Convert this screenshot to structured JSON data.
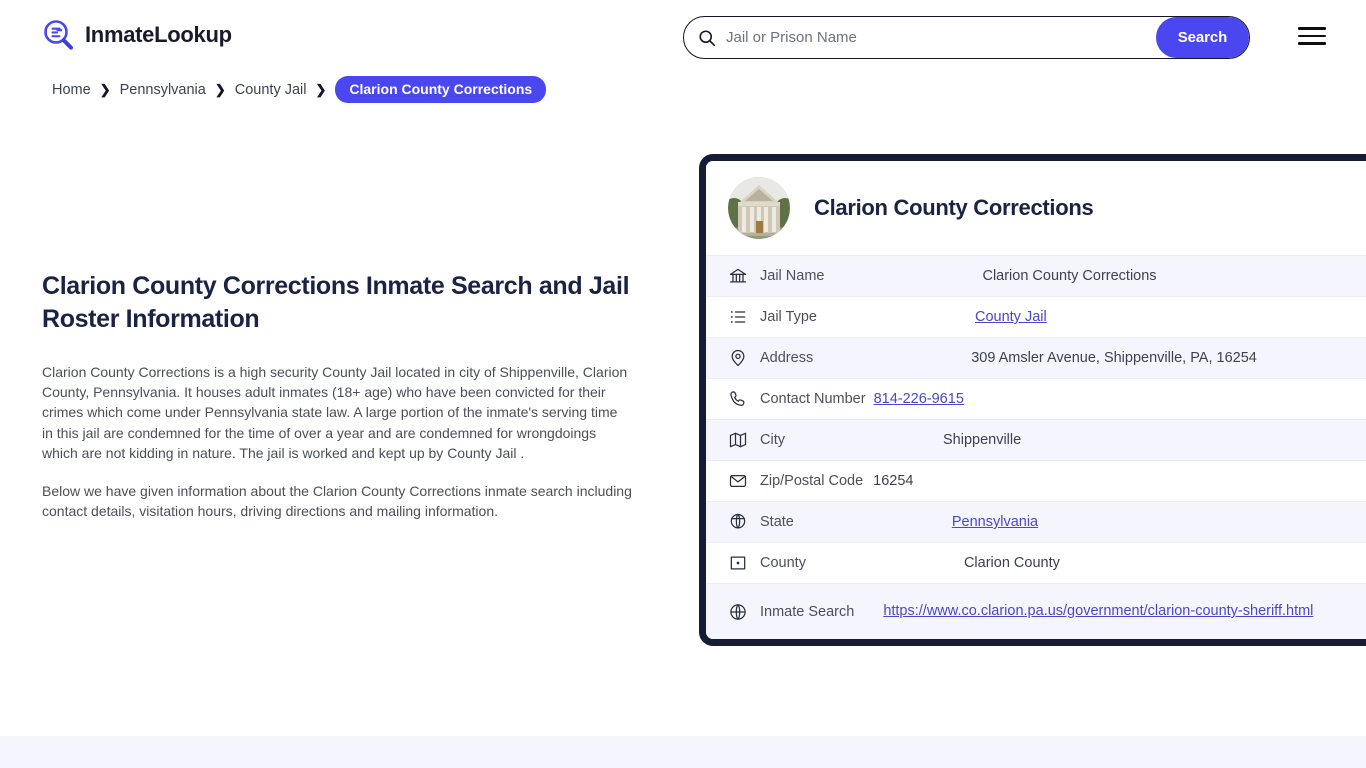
{
  "header": {
    "logo_text": "InmateLookup",
    "logo_icon": "magnifier-list-icon",
    "search": {
      "placeholder": "Jail or Prison Name",
      "value": "",
      "icon": "search-icon",
      "button_label": "Search"
    },
    "menu_icon": "hamburger-menu-icon"
  },
  "breadcrumb": {
    "items": [
      {
        "label": "Home"
      },
      {
        "label": "Pennsylvania"
      },
      {
        "label": "County Jail"
      }
    ],
    "separator": "❯",
    "current": "Clarion County Corrections"
  },
  "main": {
    "title": "Clarion County Corrections Inmate Search and Jail Roster Information",
    "paragraph_1": "Clarion County Corrections is a high security County Jail located in city of Shippenville, Clarion County, Pennsylvania. It houses adult inmates (18+ age) who have been convicted for their crimes which come under Pennsylvania state law. A large portion of the inmate's serving time in this jail are condemned for the time of over a year and are condemned for wrongdoings which are not kidding in nature. The jail is worked and kept up by County Jail .",
    "paragraph_2": "Below we have given information about the Clarion County Corrections inmate search including contact details, visitation hours, driving directions and mailing information."
  },
  "card": {
    "avatar_icon": "courthouse-photo",
    "title": "Clarion County Corrections",
    "rows": [
      {
        "icon": "bank-icon",
        "label": "Jail Name",
        "value": "Clarion County Corrections",
        "link": false
      },
      {
        "icon": "list-icon",
        "label": "Jail Type",
        "value": "County Jail",
        "link": true
      },
      {
        "icon": "map-pin-icon",
        "label": "Address",
        "value": "309 Amsler Avenue, Shippenville, PA, 16254",
        "link": false
      },
      {
        "icon": "phone-icon",
        "label": "Contact Number",
        "value": "814-226-9615",
        "link": true
      },
      {
        "icon": "map-icon",
        "label": "City",
        "value": "Shippenville",
        "link": false
      },
      {
        "icon": "envelope-icon",
        "label": "Zip/Postal Code",
        "value": "16254",
        "link": false
      },
      {
        "icon": "globe-pin-icon",
        "label": "State",
        "value": "Pennsylvania",
        "link": true
      },
      {
        "icon": "county-icon",
        "label": "County",
        "value": "Clarion County",
        "link": false
      },
      {
        "icon": "globe-icon",
        "label": "Inmate Search",
        "value": "https://www.co.clarion.pa.us/government/clarion-county-sheriff.html",
        "link": true
      }
    ]
  },
  "colors": {
    "accent": "#4a47f0",
    "link": "#4a47c8",
    "card_border": "#141c36",
    "title": "#1b2345",
    "row_alt_bg": "#f5f6fd",
    "footer_band": "#f5f5fd"
  }
}
